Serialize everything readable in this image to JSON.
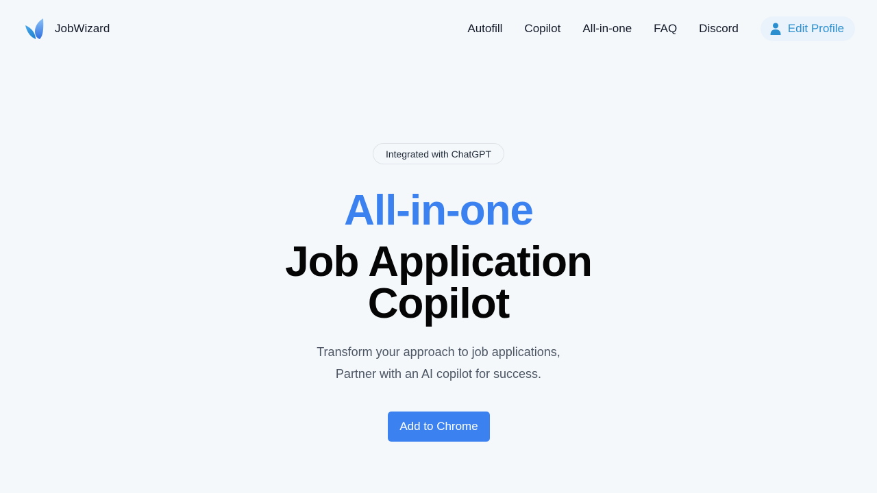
{
  "brand": {
    "name": "JobWizard",
    "logo_icon": "leaf-logo-icon",
    "logo_colors": [
      "#7bb6f5",
      "#2f6fe0",
      "#1e90d6"
    ]
  },
  "nav": {
    "links": [
      "Autofill",
      "Copilot",
      "All-in-one",
      "FAQ",
      "Discord"
    ],
    "profile_button": {
      "label": "Edit Profile",
      "icon": "user-icon"
    }
  },
  "hero": {
    "badge": "Integrated with ChatGPT",
    "headline_accent": "All-in-one",
    "headline_line1": "Job Application",
    "headline_line2": "Copilot",
    "subtitle_line1": "Transform your approach to job applications,",
    "subtitle_line2": "Partner with an AI copilot for success.",
    "cta": "Add to Chrome"
  },
  "colors": {
    "background": "#f4f8fa",
    "accent": "#3b82f0",
    "profile_text": "#2b8fcf",
    "profile_bg": "#eaf3fb"
  }
}
